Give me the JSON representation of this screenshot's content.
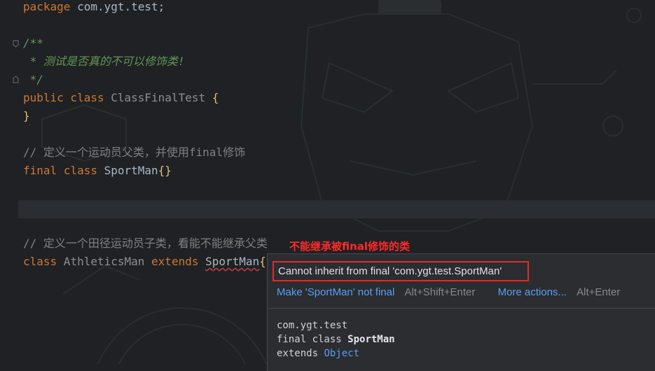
{
  "editor": {
    "lines": {
      "package_kw": "package",
      "package_name": " com.ygt.test;",
      "doc_open": "/**",
      "doc_body": " * 测试是否真的不可以修饰类!",
      "doc_close": " */",
      "public_kw": "public",
      "class_kw_1": " class ",
      "class_name_1": "ClassFinalTest",
      "open_brace_1": " {",
      "close_brace_1": "}",
      "comment_1": "// 定义一个运动员父类，并使用final修饰",
      "final_kw": "final",
      "class_kw_2": " class ",
      "class_name_2": "SportMan",
      "braces_2": "{}",
      "comment_2": "// 定义一个田径运动员子类，看能不能继承父类",
      "class_kw_3": "class",
      "class_name_3": " AthleticsMan",
      "extends_kw": " extends ",
      "super_name": "SportMan",
      "braces_3": "{}"
    }
  },
  "annotation": "不能继承被final修饰的类",
  "popup": {
    "error_message": "Cannot inherit from final 'com.ygt.test.SportMan'",
    "quick_fix": "Make 'SportMan' not final",
    "quick_fix_shortcut": "Alt+Shift+Enter",
    "more_actions": "More actions...",
    "more_actions_shortcut": "Alt+Enter",
    "doc_package": "com.ygt.test",
    "doc_decl_prefix": "final class ",
    "doc_decl_name": "SportMan",
    "doc_extends_prefix": "extends ",
    "doc_extends_name": "Object"
  },
  "colors": {
    "background": "#1f2124",
    "keyword": "#cc7832",
    "javadoc": "#629755",
    "comment": "#808080",
    "error": "#e02b2b",
    "link": "#589df6"
  }
}
